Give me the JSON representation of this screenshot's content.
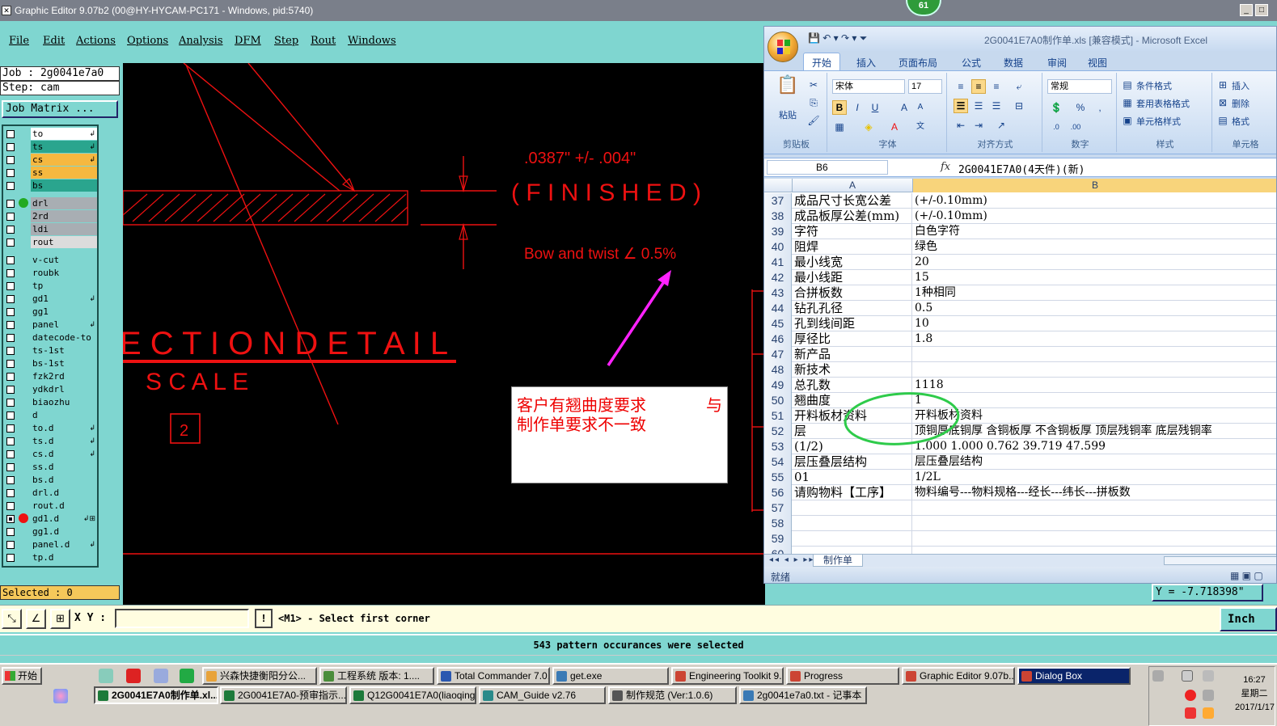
{
  "ge": {
    "title": "Graphic Editor 9.07b2 (00@HY-HYCAM-PC171 - Windows, pid:5740)",
    "badge": "61",
    "menu": [
      "File",
      "Edit",
      "Actions",
      "Options",
      "Analysis",
      "DFM",
      "Step",
      "Rout",
      "Windows"
    ],
    "job_line": "Job : 2g0041e7a0",
    "step_line": "Step: cam",
    "job_matrix_label": "Job Matrix ...",
    "selected_label": "Selected : 0",
    "layers": [
      {
        "name": "to",
        "color": "#ffffff",
        "mark": "↲",
        "dot": ""
      },
      {
        "name": "ts",
        "color": "#2aa58e",
        "mark": "↲",
        "dot": ""
      },
      {
        "name": "cs",
        "color": "#f5b840",
        "mark": "↲",
        "dot": ""
      },
      {
        "name": "ss",
        "color": "#f5b840",
        "mark": "",
        "dot": ""
      },
      {
        "name": "bs",
        "color": "#2aa58e",
        "mark": "",
        "dot": ""
      },
      {
        "name": "drl",
        "color": "#a8aeb3",
        "mark": "",
        "dot": "#22aa22"
      },
      {
        "name": "2rd",
        "color": "#a8aeb3",
        "mark": "",
        "dot": ""
      },
      {
        "name": "ldi",
        "color": "#a8aeb3",
        "mark": "",
        "dot": ""
      },
      {
        "name": "rout",
        "color": "#dcdcdc",
        "mark": "",
        "dot": ""
      },
      {
        "name": "v-cut",
        "color": "#7fd6d0",
        "mark": "",
        "dot": ""
      },
      {
        "name": "roubk",
        "color": "#7fd6d0",
        "mark": "",
        "dot": ""
      },
      {
        "name": "tp",
        "color": "#7fd6d0",
        "mark": "",
        "dot": ""
      },
      {
        "name": "gd1",
        "color": "#7fd6d0",
        "mark": "↲",
        "dot": ""
      },
      {
        "name": "gg1",
        "color": "#7fd6d0",
        "mark": "",
        "dot": ""
      },
      {
        "name": "panel",
        "color": "#7fd6d0",
        "mark": "↲",
        "dot": ""
      },
      {
        "name": "datecode-to",
        "color": "#7fd6d0",
        "mark": "",
        "dot": ""
      },
      {
        "name": "ts-1st",
        "color": "#7fd6d0",
        "mark": "",
        "dot": ""
      },
      {
        "name": "bs-1st",
        "color": "#7fd6d0",
        "mark": "",
        "dot": ""
      },
      {
        "name": "fzk2rd",
        "color": "#7fd6d0",
        "mark": "",
        "dot": ""
      },
      {
        "name": "ydkdrl",
        "color": "#7fd6d0",
        "mark": "",
        "dot": ""
      },
      {
        "name": "biaozhu",
        "color": "#7fd6d0",
        "mark": "",
        "dot": ""
      },
      {
        "name": "d",
        "color": "#7fd6d0",
        "mark": "",
        "dot": ""
      },
      {
        "name": "to.d",
        "color": "#7fd6d0",
        "mark": "↲",
        "dot": ""
      },
      {
        "name": "ts.d",
        "color": "#7fd6d0",
        "mark": "↲",
        "dot": ""
      },
      {
        "name": "cs.d",
        "color": "#7fd6d0",
        "mark": "↲",
        "dot": ""
      },
      {
        "name": "ss.d",
        "color": "#7fd6d0",
        "mark": "",
        "dot": ""
      },
      {
        "name": "bs.d",
        "color": "#7fd6d0",
        "mark": "",
        "dot": ""
      },
      {
        "name": "drl.d",
        "color": "#7fd6d0",
        "mark": "",
        "dot": ""
      },
      {
        "name": "rout.d",
        "color": "#7fd6d0",
        "mark": "",
        "dot": ""
      },
      {
        "name": "gd1.d",
        "color": "#7fd6d0",
        "mark": "↲⊞",
        "dot": "#ee1111",
        "checked": true
      },
      {
        "name": "gg1.d",
        "color": "#7fd6d0",
        "mark": "",
        "dot": ""
      },
      {
        "name": "panel.d",
        "color": "#7fd6d0",
        "mark": "↲",
        "dot": ""
      },
      {
        "name": "tp.d",
        "color": "#7fd6d0",
        "mark": "",
        "dot": ""
      }
    ],
    "canvas": {
      "tolerance_text": ".0387\" +/- .004\"",
      "finished_text": "( F I N I S H E D )",
      "bow_text": "Bow and twist ∠ 0.5%",
      "section_text": "E C T I O N   D E T A I L",
      "scale_text": "S C A L E",
      "box_number": "2",
      "note_line1": "客户有翘曲度要求",
      "note_line1b": "与",
      "note_line2": "制作单要求不一致"
    },
    "y_readout": "Y = -7.718398\"",
    "xy_label": "X Y :",
    "excl_label": "!",
    "prompt": "<M1> - Select first corner",
    "unit": "Inch",
    "status_message": "543 pattern occurances were selected"
  },
  "excel": {
    "title": "2G0041E7A0制作单.xls  [兼容模式] - Microsoft Excel",
    "tabs": [
      "开始",
      "插入",
      "页面布局",
      "公式",
      "数据",
      "审阅",
      "视图"
    ],
    "ribbon": {
      "paste": "粘贴",
      "font_name": "宋体",
      "font_size": "17",
      "number_format": "常规",
      "cond_format": "条件格式",
      "table_format": "套用表格格式",
      "cell_style": "单元格样式",
      "insert": "插入",
      "delete": "删除",
      "format": "格式",
      "groups": [
        "剪贴板",
        "字体",
        "对齐方式",
        "数字",
        "样式",
        "单元格"
      ]
    },
    "name_box": "B6",
    "fx": "fx",
    "formula": "2G0041E7A0(4天件)(新)",
    "col_a": "A",
    "col_b": "B",
    "rows": [
      {
        "n": "37",
        "a": "成品尺寸长宽公差",
        "b": "(+/-0.10mm)"
      },
      {
        "n": "38",
        "a": "成品板厚公差(mm)",
        "b": "(+/-0.10mm)"
      },
      {
        "n": "39",
        "a": "字符",
        "b": "白色字符"
      },
      {
        "n": "40",
        "a": "阻焊",
        "b": "绿色"
      },
      {
        "n": "41",
        "a": "最小线宽",
        "b": "20"
      },
      {
        "n": "42",
        "a": "最小线距",
        "b": "15"
      },
      {
        "n": "43",
        "a": "合拼板数",
        "b": "1种相同"
      },
      {
        "n": "44",
        "a": "钻孔孔径",
        "b": "0.5"
      },
      {
        "n": "45",
        "a": "孔到线间距",
        "b": "10"
      },
      {
        "n": "46",
        "a": "厚径比",
        "b": "1.8"
      },
      {
        "n": "47",
        "a": "新产品",
        "b": ""
      },
      {
        "n": "48",
        "a": "新技术",
        "b": ""
      },
      {
        "n": "49",
        "a": "总孔数",
        "b": "1118"
      },
      {
        "n": "50",
        "a": "翘曲度",
        "b": "1"
      },
      {
        "n": "51",
        "a": "开料板材资料",
        "b": "开料板材资料"
      },
      {
        "n": "52",
        "a": "层",
        "b": "顶铜厚底铜厚 含铜板厚 不含铜板厚 顶层残铜率 底层残铜率"
      },
      {
        "n": "53",
        "a": "(1/2)",
        "b": "1.000  1.000         0.762      39.719    47.599"
      },
      {
        "n": "54",
        "a": "层压叠层结构",
        "b": "层压叠层结构"
      },
      {
        "n": "55",
        "a": "01",
        "b": "1/2L"
      },
      {
        "n": "56",
        "a": "请购物料【工序】",
        "b": "物料编号---物料规格---经长---纬长---拼板数"
      },
      {
        "n": "57",
        "a": "",
        "b": ""
      },
      {
        "n": "58",
        "a": "",
        "b": ""
      },
      {
        "n": "59",
        "a": "",
        "b": ""
      },
      {
        "n": "60",
        "a": "",
        "b": ""
      }
    ],
    "sheet_tab": "制作单",
    "status": "就绪"
  },
  "taskbar": {
    "start": "开始",
    "row1": [
      {
        "label": "兴森快捷衡阳分公...",
        "color": "#e8a33a"
      },
      {
        "label": "工程系统  版本: 1....",
        "color": "#4a8d3a"
      },
      {
        "label": "Total Commander 7.0...",
        "color": "#2a58b0"
      },
      {
        "label": "get.exe",
        "color": "#3a7ab5"
      },
      {
        "label": "Engineering Toolkit 9....",
        "color": "#c43"
      },
      {
        "label": "Progress",
        "color": "#c43"
      },
      {
        "label": "Graphic Editor 9.07b...",
        "color": "#c43"
      },
      {
        "label": "Dialog Box",
        "color": "#c43"
      }
    ],
    "row2": [
      {
        "label": "2G0041E7A0制作单.xl...",
        "color": "#1d7a3a"
      },
      {
        "label": "2G0041E7A0-预审指示....",
        "color": "#1d7a3a"
      },
      {
        "label": "Q12G0041E7A0(liaoqing)...",
        "color": "#1d7a3a"
      },
      {
        "label": "CAM_Guide v2.76",
        "color": "#2a8a8a"
      },
      {
        "label": "制作规范 (Ver:1.0.6)",
        "color": "#555"
      },
      {
        "label": "2g0041e7a0.txt - 记事本",
        "color": "#3a7ab5"
      }
    ],
    "time": "16:27",
    "weekday": "星期二",
    "date": "2017/1/17"
  }
}
